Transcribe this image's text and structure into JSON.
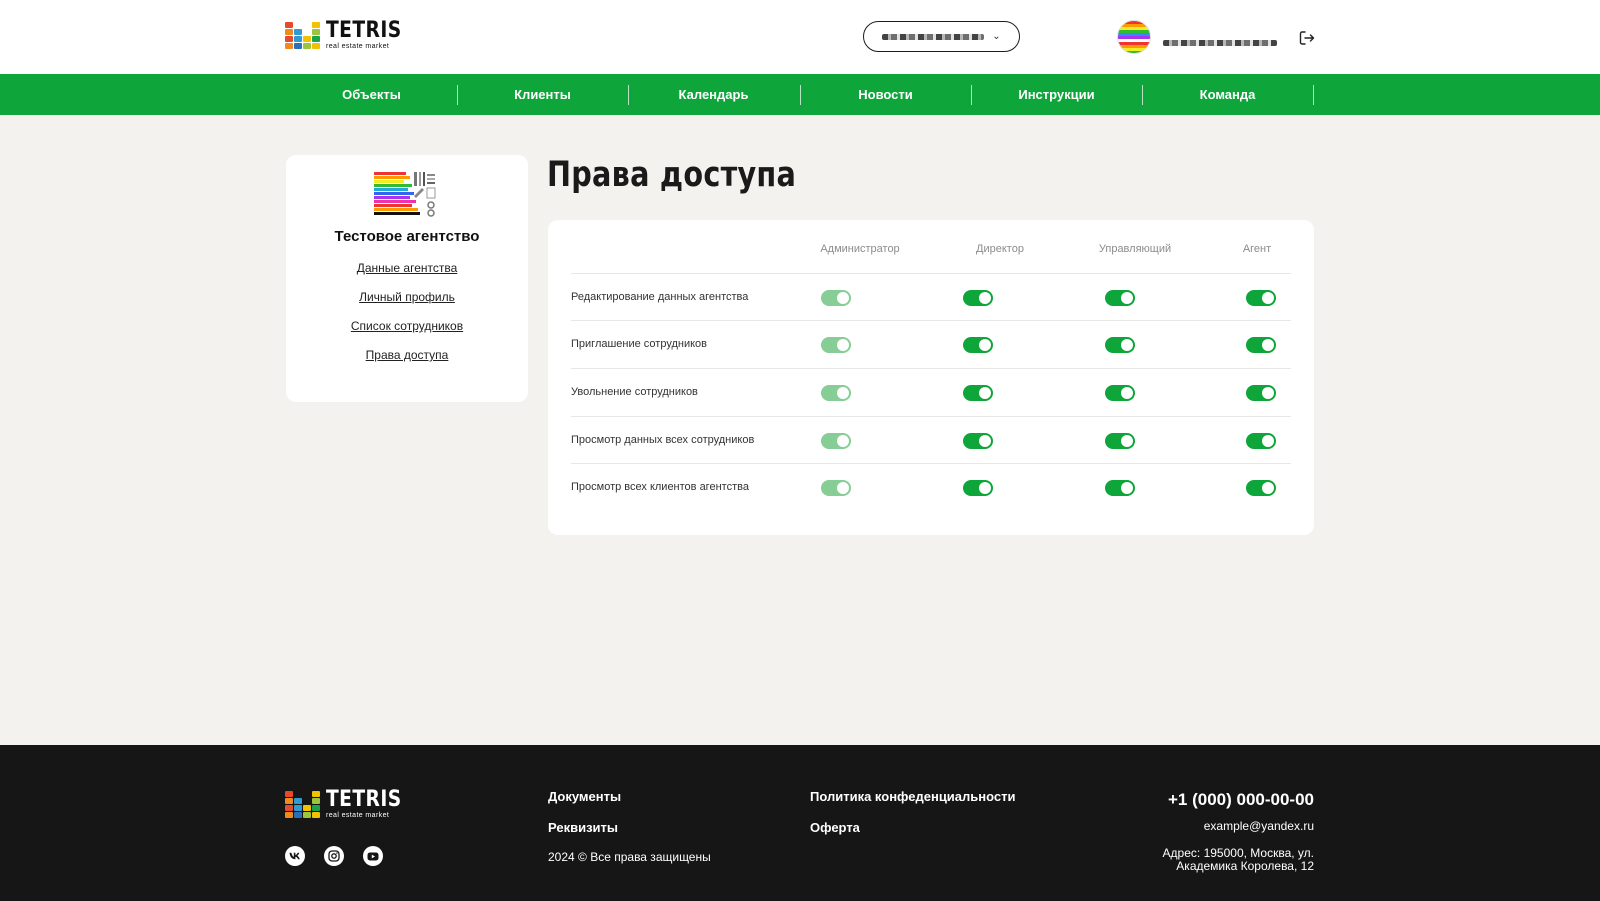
{
  "brand": {
    "name": "TETRIS",
    "tagline": "real estate market"
  },
  "header": {
    "agency_selector": {
      "value": "",
      "icon": "chevron-down-icon"
    },
    "user": {
      "name": "",
      "icon_avatar": "avatar",
      "logout_icon": "logout-icon"
    }
  },
  "nav": {
    "items": [
      {
        "label": "Объекты"
      },
      {
        "label": "Клиенты"
      },
      {
        "label": "Календарь"
      },
      {
        "label": "Новости"
      },
      {
        "label": "Инструкции"
      },
      {
        "label": "Команда"
      }
    ]
  },
  "sidebar": {
    "agency_name": "Тестовое агентство",
    "links": [
      {
        "label": "Данные агентства"
      },
      {
        "label": "Личный профиль"
      },
      {
        "label": "Список сотрудников"
      },
      {
        "label": "Права доступа"
      }
    ]
  },
  "page": {
    "title": "Права доступа"
  },
  "permissions": {
    "columns": [
      "Администратор",
      "Директор",
      "Управляющий",
      "Агент"
    ],
    "rows": [
      {
        "label": "Редактирование данных агентства",
        "values": [
          true,
          true,
          true,
          true
        ],
        "disabled": [
          true,
          false,
          false,
          false
        ]
      },
      {
        "label": "Приглашение сотрудников",
        "values": [
          true,
          true,
          true,
          true
        ],
        "disabled": [
          true,
          false,
          false,
          false
        ]
      },
      {
        "label": "Увольнение сотрудников",
        "values": [
          true,
          true,
          true,
          true
        ],
        "disabled": [
          true,
          false,
          false,
          false
        ]
      },
      {
        "label": "Просмотр данных всех сотрудников",
        "values": [
          true,
          true,
          true,
          true
        ],
        "disabled": [
          true,
          false,
          false,
          false
        ]
      },
      {
        "label": "Просмотр всех клиентов агентства",
        "values": [
          true,
          true,
          true,
          true
        ],
        "disabled": [
          true,
          false,
          false,
          false
        ]
      }
    ],
    "colors": {
      "on": "#0ea63a",
      "disabled_on": "#86ce96"
    }
  },
  "footer": {
    "links_col1": [
      "Документы",
      "Реквизиты"
    ],
    "links_col2": [
      "Политика конфеденциальности",
      "Оферта"
    ],
    "copyright": "2024 © Все права защищены",
    "phone": "+1 (000) 000-00-00",
    "email": "example@yandex.ru",
    "address": "Адрес: 195000, Москва, ул. Академика Королева, 12",
    "social": [
      "vk-icon",
      "instagram-icon",
      "youtube-icon"
    ]
  },
  "colors": {
    "accent": "#0ea63a",
    "footer_bg": "#161616",
    "page_bg": "#f3f2ef"
  }
}
